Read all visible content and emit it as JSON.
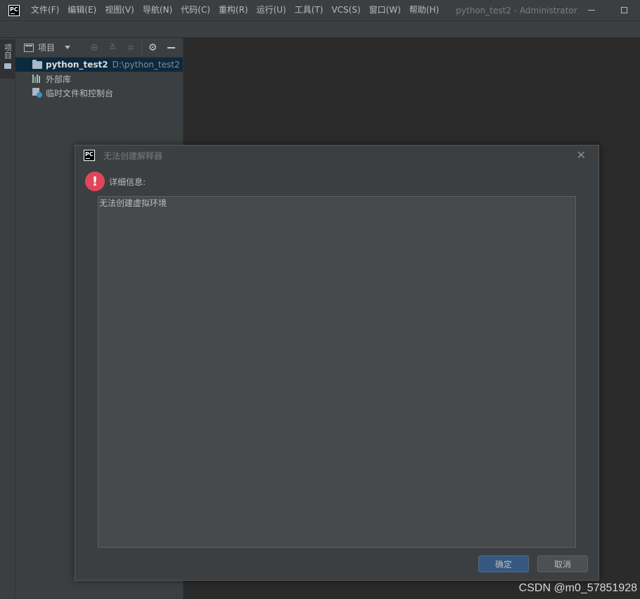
{
  "app": {
    "logo_text": "PC",
    "window_title": "python_test2 - Administrator"
  },
  "menu": {
    "items": [
      {
        "label": "文件(F)"
      },
      {
        "label": "编辑(E)"
      },
      {
        "label": "视图(V)"
      },
      {
        "label": "导航(N)"
      },
      {
        "label": "代码(C)"
      },
      {
        "label": "重构(R)"
      },
      {
        "label": "运行(U)"
      },
      {
        "label": "工具(T)"
      },
      {
        "label": "VCS(S)"
      },
      {
        "label": "窗口(W)"
      },
      {
        "label": "帮助(H)"
      }
    ]
  },
  "tool_stripe": {
    "project_label": "项目"
  },
  "project_panel": {
    "title": "项目",
    "tree": {
      "root_name": "python_test2",
      "root_path": "D:\\python_test2",
      "external_libraries": "外部库",
      "scratches": "临时文件和控制台"
    }
  },
  "dialog": {
    "logo_text": "PC",
    "title": "无法创建解释器",
    "detail_label": "详细信息:",
    "detail_text": "无法创建虚拟环境",
    "ok_label": "确定",
    "cancel_label": "取消"
  },
  "watermark": "CSDN @m0_57851928",
  "colors": {
    "error": "#e0465b",
    "primary_button": "#365880",
    "selection": "#0d293e"
  }
}
